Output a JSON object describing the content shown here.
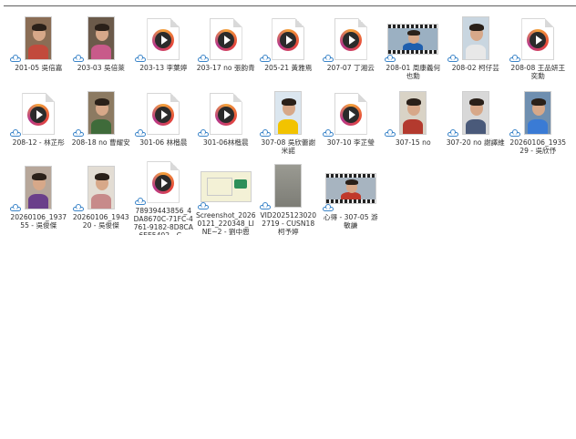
{
  "files": [
    [
      {
        "label": "201-05 吳倍嘉",
        "thumb": "photo-portrait",
        "icon": "photo-thumbnail-icon",
        "colors": [
          "#8a6d55",
          "#c24a3c"
        ]
      },
      {
        "label": "203-03 吳倍萊",
        "thumb": "photo-portrait",
        "icon": "photo-thumbnail-icon",
        "colors": [
          "#6b5a4a",
          "#c85a8a"
        ]
      },
      {
        "label": "203-13 李葉婷",
        "thumb": "video",
        "icon": "video-file-icon"
      },
      {
        "label": "203-17 no 張韵青",
        "thumb": "video",
        "icon": "video-file-icon"
      },
      {
        "label": "205-21 黃雅焉",
        "thumb": "video",
        "icon": "video-file-icon"
      },
      {
        "label": "207-07 丁湘云",
        "thumb": "video",
        "icon": "video-file-icon"
      },
      {
        "label": "208-01 周康義何也勳",
        "thumb": "photo-landscape-film",
        "icon": "video-thumbnail-icon",
        "colors": [
          "#9bb0c2",
          "#1f5fae"
        ]
      },
      {
        "label": "208-02 柯仔芸",
        "thumb": "photo-portrait",
        "icon": "photo-thumbnail-icon",
        "colors": [
          "#c9d6e0",
          "#e8e8e8"
        ]
      },
      {
        "label": "208-08 王品妍王奕勳",
        "thumb": "video",
        "icon": "video-file-icon"
      }
    ],
    [
      {
        "label": "208-12 - 林芷彤",
        "thumb": "video",
        "icon": "video-file-icon"
      },
      {
        "label": "208-18 no 曹耀安",
        "thumb": "photo-portrait",
        "icon": "photo-thumbnail-icon",
        "colors": [
          "#8c7a62",
          "#3f6b3a"
        ]
      },
      {
        "label": "301-06 林楷晨",
        "thumb": "video",
        "icon": "video-file-icon"
      },
      {
        "label": "301-06林楷晨",
        "thumb": "video",
        "icon": "video-file-icon"
      },
      {
        "label": "307-08 吳欣蕾謝米諾",
        "thumb": "photo-portrait",
        "icon": "photo-thumbnail-icon",
        "colors": [
          "#dbe6ef",
          "#f2c300"
        ]
      },
      {
        "label": "307-10 李芷瑩",
        "thumb": "video",
        "icon": "video-file-icon"
      },
      {
        "label": "307-15 no",
        "thumb": "photo-portrait",
        "icon": "photo-thumbnail-icon",
        "colors": [
          "#d9d3c6",
          "#b33a2e"
        ]
      },
      {
        "label": "307-20 no 謝譯維",
        "thumb": "photo-portrait",
        "icon": "photo-thumbnail-icon",
        "colors": [
          "#d8d8d8",
          "#4a5a7a"
        ]
      },
      {
        "label": "20260106_193529 - 吳欣伃",
        "thumb": "photo-portrait",
        "icon": "photo-thumbnail-icon",
        "colors": [
          "#6f8fb0",
          "#3a7bd5"
        ]
      }
    ],
    [
      {
        "label": "20260106_193755 - 吳俊傑",
        "thumb": "photo-portrait",
        "icon": "photo-thumbnail-icon",
        "colors": [
          "#b7a79a",
          "#6a3f8a"
        ]
      },
      {
        "label": "20260106_194320 - 吳俊傑",
        "thumb": "photo-portrait",
        "icon": "photo-thumbnail-icon",
        "colors": [
          "#e3ddd4",
          "#c78a8a"
        ]
      },
      {
        "label": "78939443856_4DA8670C-71FC-4761-9182-8D8CA6EE5402 - C...",
        "thumb": "video",
        "icon": "video-file-icon"
      },
      {
        "label": "Screenshot_20260121_220348_LINE~2 - 劉中恩",
        "thumb": "photo-landscape",
        "icon": "photo-thumbnail-icon",
        "colors": [
          "#f3f1d6",
          "#2d8f5a"
        ]
      },
      {
        "label": "VID20251230202719 - CUSN18 柯予婷",
        "thumb": "photo-portrait-blank",
        "icon": "video-thumbnail-icon",
        "colors": [
          "#9a9a92",
          "#7d7d76"
        ]
      },
      {
        "label": "心得 - 307-05 游敏謙",
        "thumb": "photo-landscape-film",
        "icon": "video-thumbnail-icon",
        "colors": [
          "#a7b4c0",
          "#c0392b"
        ]
      }
    ]
  ],
  "accent": {
    "cloud": "#3a84c8",
    "divider": "#5f5f5f"
  }
}
